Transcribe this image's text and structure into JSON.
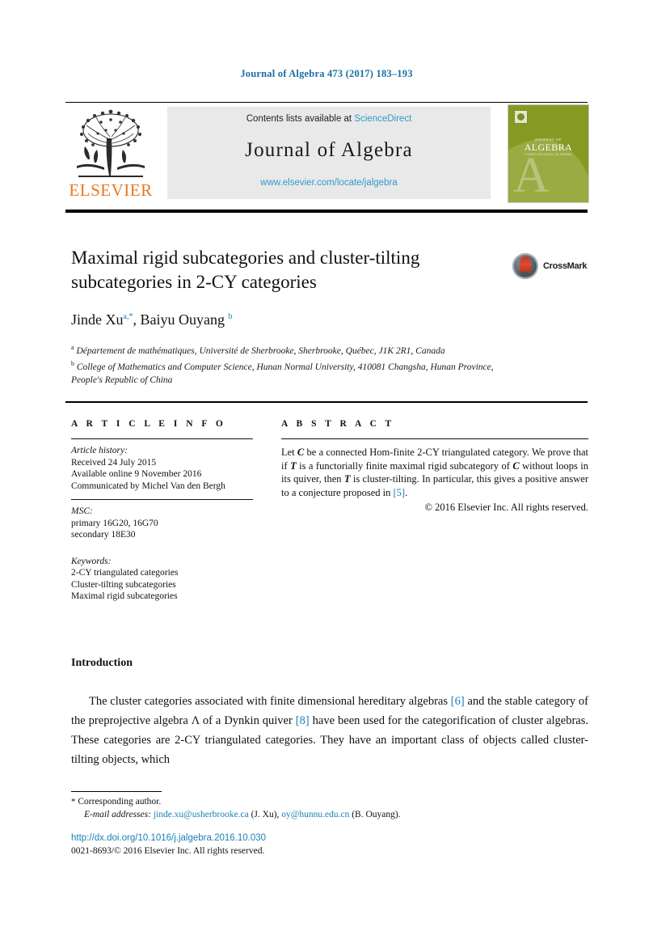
{
  "running_head": "Journal of Algebra 473 (2017) 183–193",
  "masthead": {
    "contents_prefix": "Contents lists available at ",
    "sciencedirect": "ScienceDirect",
    "journal_title": "Journal of Algebra",
    "url": "www.elsevier.com/locate/jalgebra",
    "publisher": "ELSEVIER",
    "publisher_logo_icon": "elsevier-tree-icon",
    "cover": {
      "journal_of": "JOURNAL OF",
      "algebra": "ALGEBRA",
      "subtitle": "COMPUTATIONAL ALGEBRA"
    }
  },
  "article": {
    "title": "Maximal rigid subcategories and cluster-tilting subcategories in 2-CY categories",
    "crossmark_label": "CrossMark",
    "authors_html": "Jinde Xu<sup class=\"sup\">a</sup><sup class=\"sup-star\">,*</sup>, Baiyu Ouyang <sup class=\"sup\">b</sup>",
    "affiliations": [
      {
        "marker": "a",
        "text": "Département de mathématiques, Université de Sherbrooke, Sherbrooke, Québec, J1K 2R1, Canada"
      },
      {
        "marker": "b",
        "text": "College of Mathematics and Computer Science, Hunan Normal University, 410081 Changsha, Hunan Province, People's Republic of China"
      }
    ]
  },
  "info": {
    "heading": "A R T I C L E   I N F O",
    "history_label": "Article history:",
    "history": [
      "Received 24 July 2015",
      "Available online 9 November 2016",
      "Communicated by Michel Van den Bergh"
    ],
    "msc_label": "MSC:",
    "msc": [
      "primary 16G20, 16G70",
      "secondary 18E30"
    ],
    "keywords_label": "Keywords:",
    "keywords": [
      "2-CY triangulated categories",
      "Cluster-tilting subcategories",
      "Maximal rigid subcategories"
    ]
  },
  "abstract": {
    "heading": "A B S T R A C T",
    "text_html": "Let <span class=\"cal\">C</span> be a connected Hom-finite 2-CY triangulated category. We prove that if <span class=\"cal\">T</span> is a functorially finite maximal rigid subcategory of <span class=\"cal\">C</span> without loops in its quiver, then <span class=\"cal\">T</span> is cluster-tilting. In particular, this gives a positive answer to a conjecture proposed in <span class=\"ref\">[5]</span>.",
    "copyright": "© 2016 Elsevier Inc. All rights reserved."
  },
  "introduction": {
    "heading": "Introduction",
    "paragraph_html": "The cluster categories associated with finite dimensional hereditary algebras <span class=\"ref\">[6]</span> and the stable category of the preprojective algebra Λ of a Dynkin quiver <span class=\"ref\">[8]</span> have been used for the categorification of cluster algebras. These categories are 2-CY triangulated categories. They have an important class of objects called cluster-tilting objects, which"
  },
  "footer": {
    "corresponding_marker": "*",
    "corresponding_text": "Corresponding author.",
    "email_label": "E-mail addresses:",
    "emails": [
      {
        "address": "jinde.xu@usherbrooke.ca",
        "owner": "(J. Xu)"
      },
      {
        "address": "oy@hunnu.edu.cn",
        "owner": "(B. Ouyang)"
      }
    ],
    "email_line_html": "<em>E-mail addresses:</em> <span class=\"mail\">jinde.xu@usherbrooke.ca</span> (J. Xu), <span class=\"mail\">oy@hunnu.edu.cn</span> (B. Ouyang).",
    "doi": "http://dx.doi.org/10.1016/j.jalgebra.2016.10.030",
    "issn_line": "0021-8693/© 2016 Elsevier Inc. All rights reserved."
  },
  "colors": {
    "link_blue": "#1a7fb5",
    "masthead_blue": "#2e9bc9",
    "elsevier_orange": "#e87722",
    "cover_green": "#869a23"
  }
}
